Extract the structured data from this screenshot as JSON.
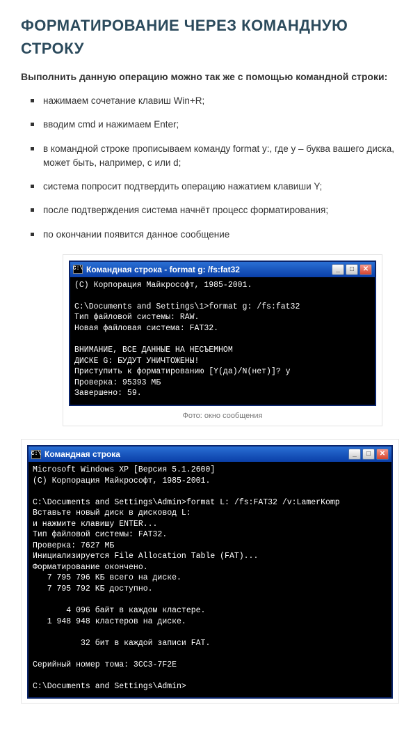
{
  "heading": "ФОРМАТИРОВАНИЕ ЧЕРЕЗ КОМАНДНУЮ СТРОКУ",
  "intro": "Выполнить данную операцию можно так же с помощью командной строки:",
  "steps": [
    "нажимаем сочетание клавиш Win+R;",
    "вводим cmd и нажимаем Enter;",
    "в командной строке прописываем команду format y:, где y – буква вашего диска, может быть, например, c или d;",
    "система попросит подтвердить операцию нажатием клавиши Y;",
    "после подтверждения система начнёт процесс форматирования;",
    "по окончании появится данное сообщение"
  ],
  "console1": {
    "title": "Командная строка - format g: /fs:fat32",
    "icon_glyph": "C:\\",
    "body": "(С) Корпорация Майкрософт, 1985-2001.\n\nC:\\Documents and Settings\\1>format g: /fs:fat32\nТип файловой системы: RAW.\nНовая файловая система: FAT32.\n\nВНИМАНИЕ, ВСЕ ДАННЫЕ НА НЕСЪЕМНОМ\nДИСКЕ G: БУДУТ УНИЧТОЖЕНЫ!\nПриступить к форматированию [Y(да)/N(нет)]? y\nПроверка: 95393 МБ\nЗавершено: 59.",
    "caption": "Фото: окно сообщения",
    "win_btns": {
      "min": "_",
      "max": "□",
      "close": "✕"
    }
  },
  "console2": {
    "title": "Командная строка",
    "icon_glyph": "C:\\",
    "body": "Microsoft Windows XP [Версия 5.1.2600]\n(С) Корпорация Майкрософт, 1985-2001.\n\nC:\\Documents and Settings\\Admin>format L: /fs:FAT32 /v:LamerKomp\nВставьте новый диск в дисковод L:\nи нажмите клавишу ENTER...\nТип файловой системы: FAT32.\nПроверка: 7627 МБ\nИнициализируется File Allocation Table (FAT)...\nФорматирование окончено.\n   7 795 796 КБ всего на диске.\n   7 795 792 КБ доступно.\n\n       4 096 байт в каждом кластере.\n   1 948 948 кластеров на диске.\n\n          32 бит в каждой записи FAT.\n\nСерийный номер тома: 3CC3-7F2E\n\nC:\\Documents and Settings\\Admin>",
    "win_btns": {
      "min": "_",
      "max": "□",
      "close": "✕"
    }
  }
}
